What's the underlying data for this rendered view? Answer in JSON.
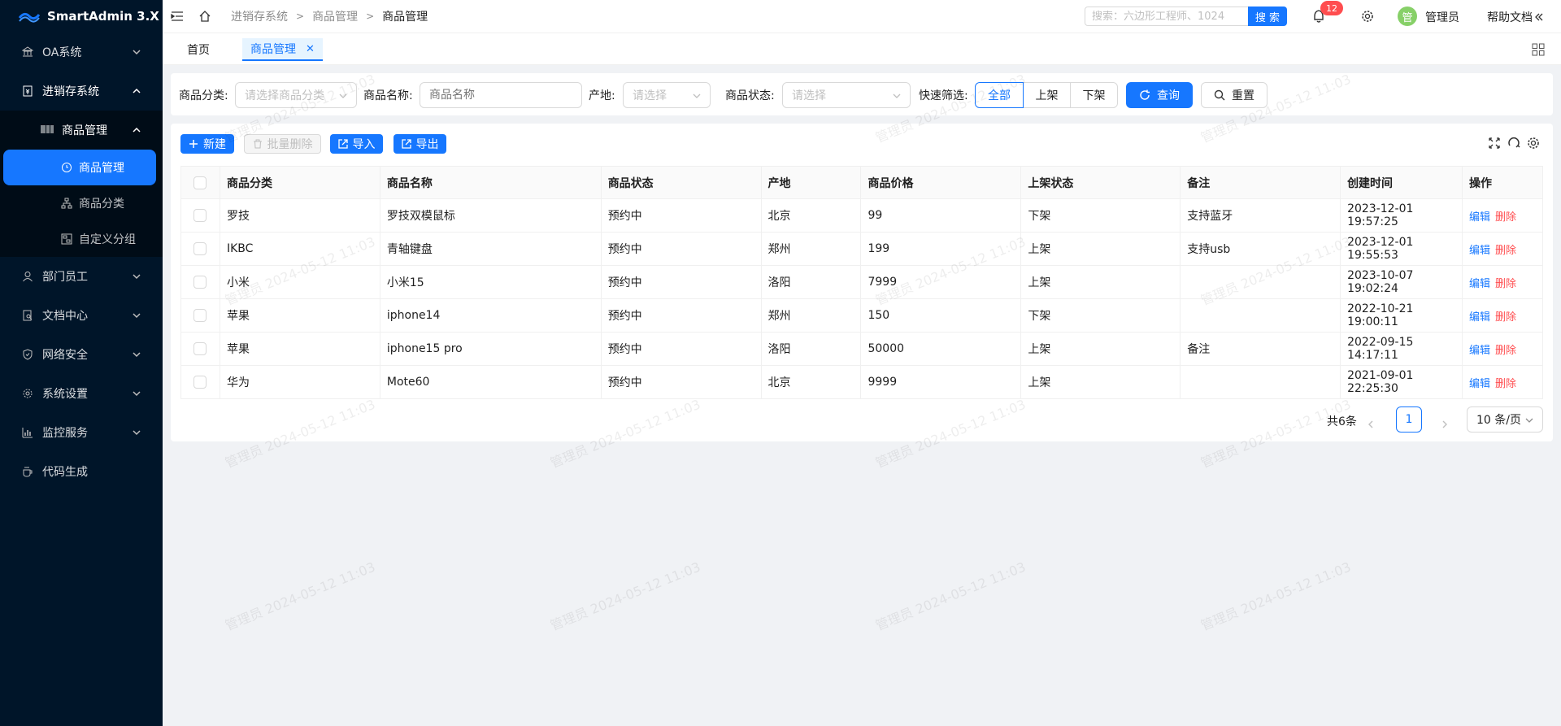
{
  "app": {
    "title": "SmartAdmin 3.X"
  },
  "sidebar": {
    "items": [
      {
        "label": "OA系统"
      },
      {
        "label": "进销存系统"
      },
      {
        "label": "商品管理"
      },
      {
        "label": "商品管理"
      },
      {
        "label": "商品分类"
      },
      {
        "label": "自定义分组"
      },
      {
        "label": "部门员工"
      },
      {
        "label": "文档中心"
      },
      {
        "label": "网络安全"
      },
      {
        "label": "系统设置"
      },
      {
        "label": "监控服务"
      },
      {
        "label": "代码生成"
      }
    ]
  },
  "header": {
    "breadcrumb": [
      "进销存系统",
      "商品管理",
      "商品管理"
    ],
    "search_placeholder": "搜索：六边形工程师、1024",
    "search_button": "搜 索",
    "notification_count": "12",
    "avatar_text": "管",
    "user_name": "管理员",
    "help_label": "帮助文档"
  },
  "tabs": [
    {
      "label": "首页"
    },
    {
      "label": "商品管理"
    }
  ],
  "filters": {
    "category_label": "商品分类:",
    "category_placeholder": "请选择商品分类",
    "name_label": "商品名称:",
    "name_placeholder": "商品名称",
    "origin_label": "产地:",
    "origin_placeholder": "请选择",
    "status_label": "商品状态:",
    "status_placeholder": "请选择",
    "quick_label": "快速筛选:",
    "quick_options": [
      "全部",
      "上架",
      "下架"
    ],
    "query_button": "查询",
    "reset_button": "重置"
  },
  "toolbar": {
    "new_button": "新建",
    "batch_delete_button": "批量删除",
    "import_button": "导入",
    "export_button": "导出"
  },
  "table": {
    "columns": [
      "商品分类",
      "商品名称",
      "商品状态",
      "产地",
      "商品价格",
      "上架状态",
      "备注",
      "创建时间",
      "操作"
    ],
    "rows": [
      [
        "罗技",
        "罗技双模鼠标",
        "预约中",
        "北京",
        "99",
        "下架",
        "支持蓝牙",
        "2023-12-01 19:57:25"
      ],
      [
        "IKBC",
        "青轴键盘",
        "预约中",
        "郑州",
        "199",
        "上架",
        "支持usb",
        "2023-12-01 19:55:53"
      ],
      [
        "小米",
        "小米15",
        "预约中",
        "洛阳",
        "7999",
        "上架",
        "",
        "2023-10-07 19:02:24"
      ],
      [
        "苹果",
        "iphone14",
        "预约中",
        "郑州",
        "150",
        "下架",
        "",
        "2022-10-21 19:00:11"
      ],
      [
        "苹果",
        "iphone15 pro",
        "预约中",
        "洛阳",
        "50000",
        "上架",
        "备注",
        "2022-09-15 14:17:11"
      ],
      [
        "华为",
        "Mote60",
        "预约中",
        "北京",
        "9999",
        "上架",
        "",
        "2021-09-01 22:25:30"
      ]
    ],
    "action_edit": "编辑",
    "action_delete": "删除"
  },
  "pagination": {
    "total_text": "共6条",
    "current_page": "1",
    "page_size": "10 条/页"
  },
  "watermark_text": "管理员 2024-05-12 11:03",
  "colors": {
    "primary": "#1677ff",
    "danger": "#ff4d4f",
    "sidebar": "#001529"
  }
}
